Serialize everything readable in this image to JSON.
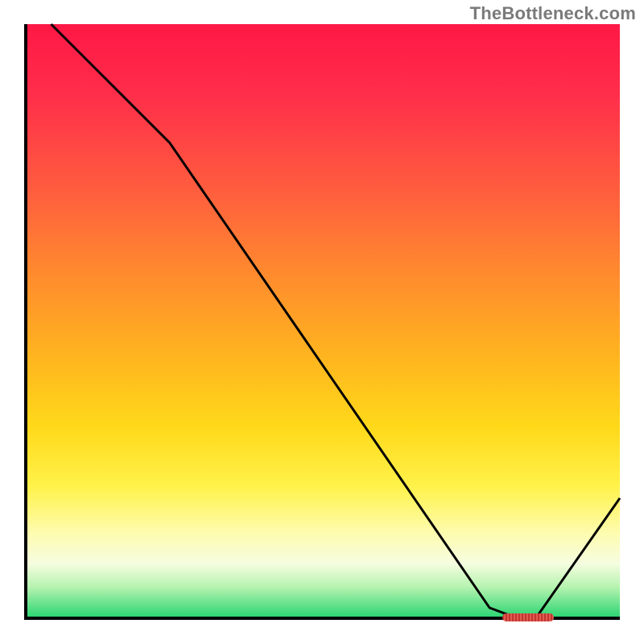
{
  "watermark": "TheBottleneck.com",
  "colors": {
    "axis": "#000000",
    "curve": "#000000",
    "watermark_text": "#7a7a7a",
    "marker": "#d0433f",
    "gradient_top": "#ff1846",
    "gradient_bottom": "#2ed573"
  },
  "chart_data": {
    "type": "line",
    "title": "",
    "xlabel": "",
    "ylabel": "",
    "xlim": [
      0,
      1
    ],
    "ylim": [
      0,
      1
    ],
    "series": [
      {
        "name": "curve",
        "x": [
          0.04,
          0.24,
          0.78,
          0.82,
          0.86,
          1.0
        ],
        "y": [
          1.0,
          0.8,
          0.015,
          0.0,
          0.0,
          0.2
        ]
      }
    ],
    "minimum_marker": {
      "x": 0.84,
      "y": 0.004
    }
  }
}
